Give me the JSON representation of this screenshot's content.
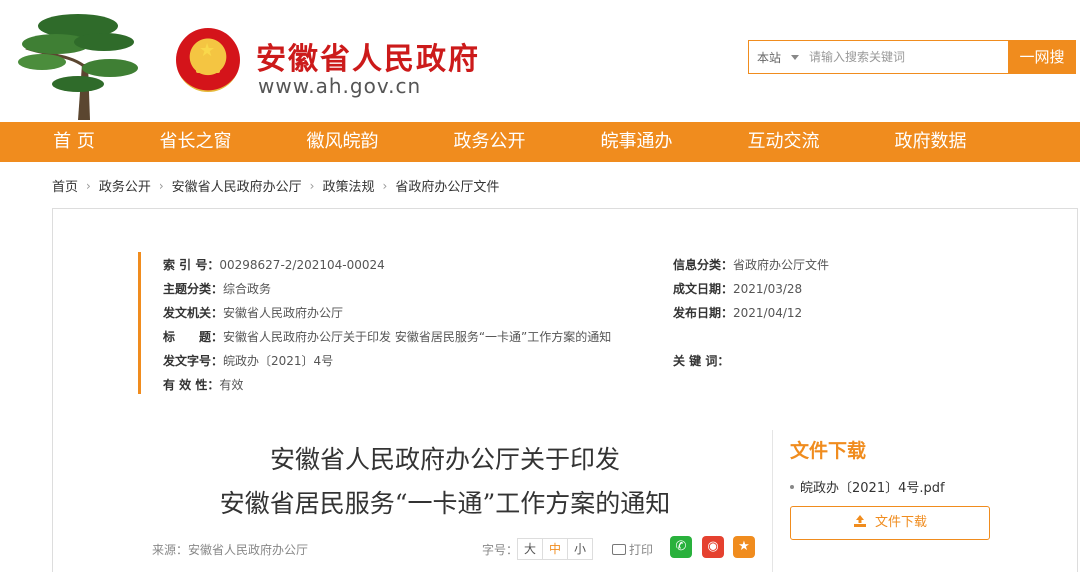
{
  "header": {
    "site_title": "安徽省人民政府",
    "site_url": "www.ah.gov.cn",
    "search": {
      "scope": "本站",
      "placeholder": "请输入搜索关键词",
      "button_label": "一网搜"
    }
  },
  "nav": {
    "items": [
      {
        "label": "首 页"
      },
      {
        "label": "省长之窗"
      },
      {
        "label": "徽风皖韵"
      },
      {
        "label": "政务公开"
      },
      {
        "label": "皖事通办"
      },
      {
        "label": "互动交流"
      },
      {
        "label": "政府数据"
      }
    ]
  },
  "breadcrumb": [
    "首页",
    "政务公开",
    "安徽省人民政府办公厅",
    "政策法规",
    "省政府办公厅文件"
  ],
  "meta": {
    "index_label": "索 引 号：",
    "index_value": "00298627-2/202104-00024",
    "category_label": "信息分类：",
    "category_value": "省政府办公厅文件",
    "topic_label": "主题分类：",
    "topic_value": "综合政务",
    "created_label": "成文日期：",
    "created_value": "2021/03/28",
    "issuer_label": "发文机关：",
    "issuer_value": "安徽省人民政府办公厅",
    "published_label": "发布日期：",
    "published_value": "2021/04/12",
    "title_label": "标　　题：",
    "title_value": "安徽省人民政府办公厅关于印发 安徽省居民服务“一卡通”工作方案的通知",
    "docno_label": "发文字号：",
    "docno_value": "皖政办〔2021〕4号",
    "keywords_label": "关 键 词：",
    "keywords_value": "",
    "validity_label": "有 效 性：",
    "validity_value": "有效"
  },
  "document": {
    "title_line1": "安徽省人民政府办公厅关于印发",
    "title_line2": "安徽省居民服务“一卡通”工作方案的通知",
    "source": "来源：安徽省人民政府办公厅",
    "font_size_label": "字号：",
    "font_sizes": [
      "大",
      "中",
      "小"
    ],
    "print_label": "打印"
  },
  "download": {
    "title": "文件下载",
    "file_name": "皖政办〔2021〕4号.pdf",
    "button_label": "文件下载"
  },
  "colors": {
    "accent": "#f08c1e",
    "brand_red": "#cc1a1a"
  }
}
